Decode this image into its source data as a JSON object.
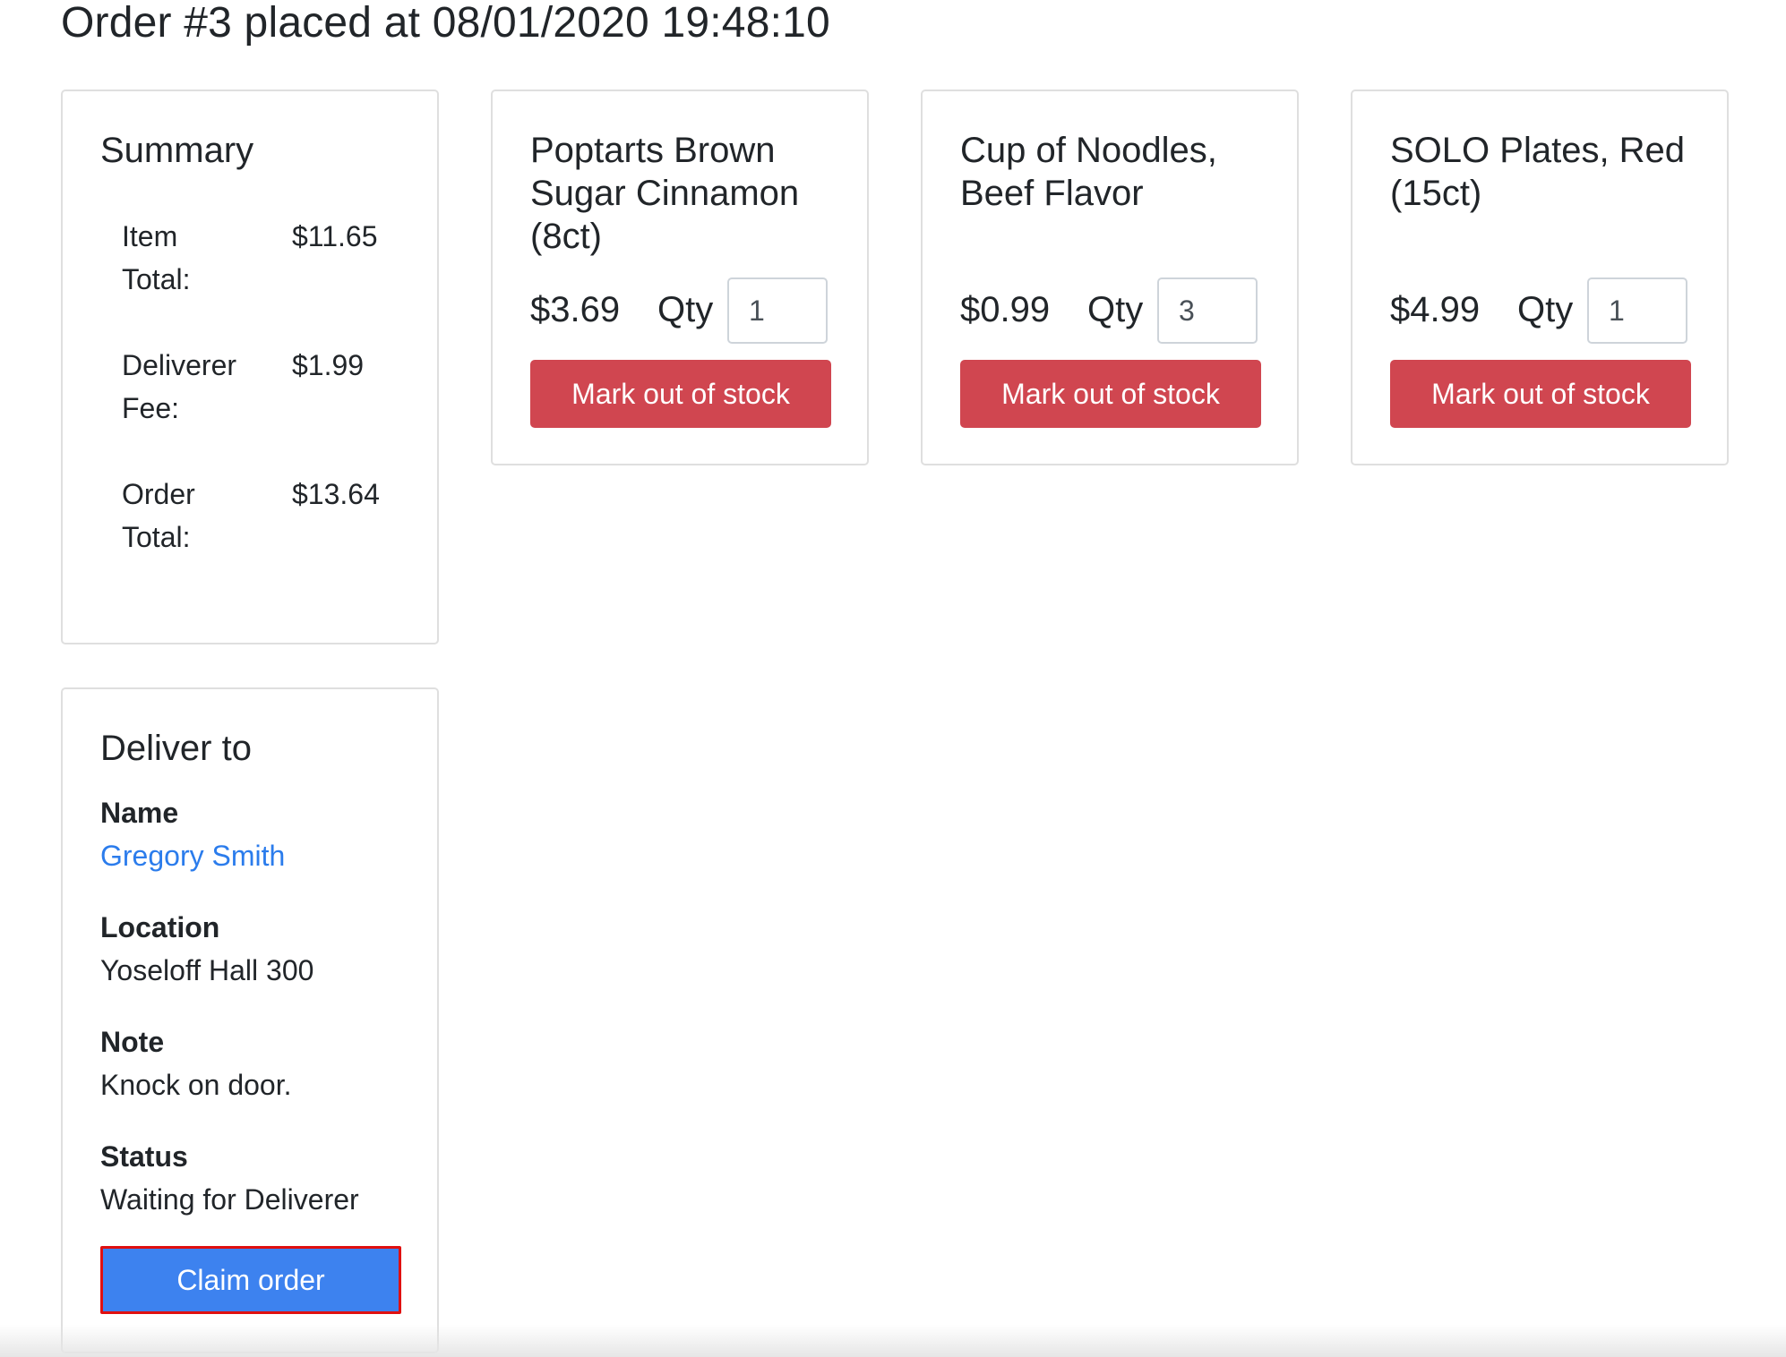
{
  "page": {
    "title": "Order #3 placed at 08/01/2020 19:48:10"
  },
  "summary": {
    "title": "Summary",
    "rows": [
      {
        "label": "Item Total:",
        "value": "$11.65"
      },
      {
        "label": "Deliverer Fee:",
        "value": "$1.99"
      },
      {
        "label": "Order Total:",
        "value": "$13.64"
      }
    ]
  },
  "items": [
    {
      "name": "Poptarts Brown Sugar Cinnamon (8ct)",
      "price": "$3.69",
      "qty_label": "Qty",
      "qty": "1",
      "button_label": "Mark out of stock"
    },
    {
      "name": "Cup of Noodles, Beef Flavor",
      "price": "$0.99",
      "qty_label": "Qty",
      "qty": "3",
      "button_label": "Mark out of stock"
    },
    {
      "name": "SOLO Plates, Red (15ct)",
      "price": "$4.99",
      "qty_label": "Qty",
      "qty": "1",
      "button_label": "Mark out of stock"
    }
  ],
  "deliver_to": {
    "title": "Deliver to",
    "name_label": "Name",
    "name": "Gregory Smith",
    "location_label": "Location",
    "location": "Yoseloff Hall 300",
    "note_label": "Note",
    "note": "Knock on door.",
    "status_label": "Status",
    "status": "Waiting for Deliverer",
    "claim_button": "Claim order"
  },
  "colors": {
    "danger": "#d04650",
    "primary": "#3d82ef",
    "link": "#2b7cec",
    "highlight_border": "#e01010"
  }
}
